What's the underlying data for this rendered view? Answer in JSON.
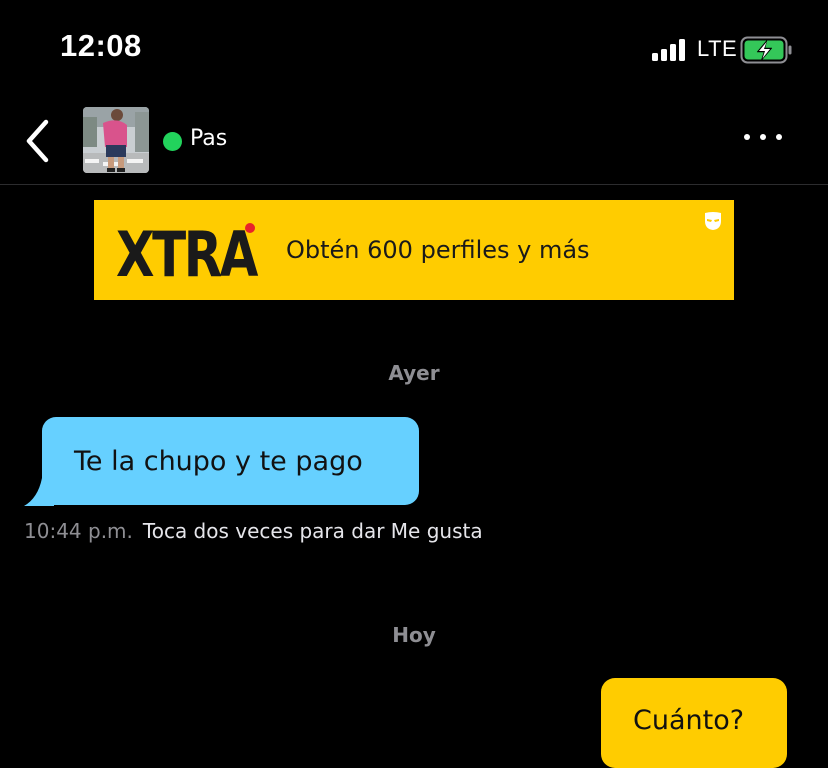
{
  "status_bar": {
    "time": "12:08",
    "network": "LTE",
    "battery_charging": true,
    "battery_color": "#34c759"
  },
  "header": {
    "profile_name": "Pas",
    "online": true,
    "online_color": "#22d35c",
    "back_icon": "chevron-left-icon",
    "more_icon": "ellipsis-icon"
  },
  "banner": {
    "logo_text": "XTRA",
    "text": "Obtén 600 perfiles y más",
    "background": "#ffcc00",
    "logo_dot_color": "#e8222a",
    "icon": "grindr-mask-icon"
  },
  "chat": {
    "day_yesterday": "Ayer",
    "day_today": "Hoy",
    "incoming_message": {
      "text": "Te la chupo y te pago",
      "time": "10:44 p.m.",
      "hint": "Toca dos veces para dar Me gusta",
      "color": "#66d0ff"
    },
    "outgoing_message": {
      "text": "Cuánto?",
      "color": "#ffcc00"
    }
  }
}
